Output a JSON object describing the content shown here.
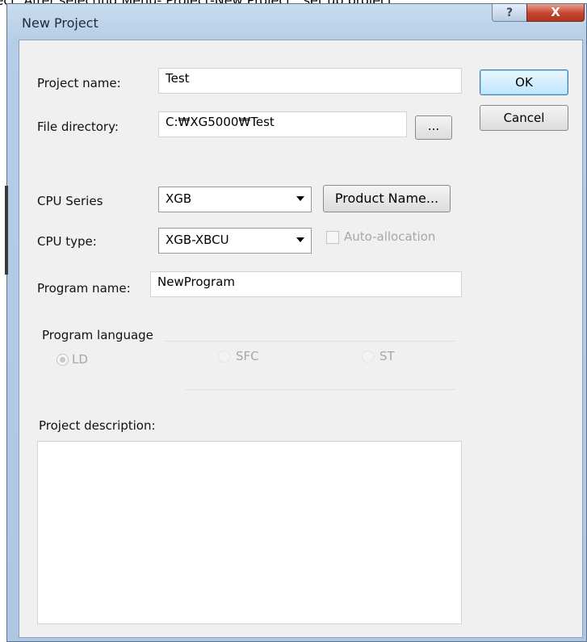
{
  "caption": "ject. After selecting Menu- Project-New Project , set up project",
  "window": {
    "title": "New Project",
    "help_label": "?",
    "close_label": "X"
  },
  "form": {
    "project_name": {
      "label": "Project name:",
      "value": "Test"
    },
    "file_directory": {
      "label": "File directory:",
      "value": "C:₩XG5000₩Test",
      "browse_label": "..."
    },
    "cpu_series": {
      "label": "CPU Series",
      "value": "XGB"
    },
    "product_name_button": "Product Name...",
    "cpu_type": {
      "label": "CPU type:",
      "value": "XGB-XBCU"
    },
    "auto_allocation": {
      "label": "Auto-allocation",
      "checked": false,
      "enabled": false
    },
    "program_name": {
      "label": "Program name:",
      "value": "NewProgram"
    },
    "program_language": {
      "label": "Program language",
      "options": [
        {
          "label": "LD",
          "selected": true
        },
        {
          "label": "SFC",
          "selected": false
        },
        {
          "label": "ST",
          "selected": false
        }
      ]
    },
    "project_description": {
      "label": "Project description:",
      "value": ""
    }
  },
  "buttons": {
    "ok": "OK",
    "cancel": "Cancel"
  }
}
